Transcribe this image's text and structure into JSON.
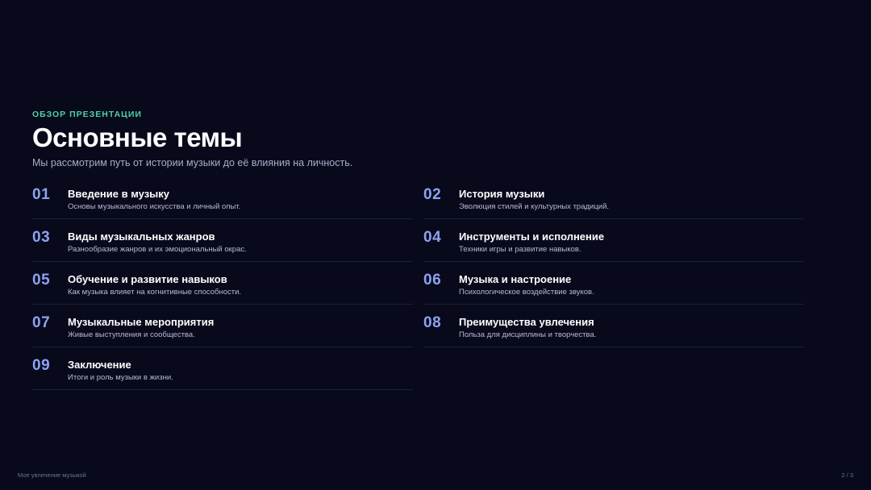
{
  "slide": {
    "eyebrow": "ОБЗОР ПРЕЗЕНТАЦИИ",
    "title": "Основные темы",
    "subtitle": "Мы рассмотрим путь от истории музыки до её влияния на личность."
  },
  "topics": [
    {
      "num": "01",
      "title": "Введение в музыку",
      "desc": "Основы музыкального искусства и личный опыт."
    },
    {
      "num": "02",
      "title": "История музыки",
      "desc": "Эволюция стилей и культурных традиций."
    },
    {
      "num": "03",
      "title": "Виды музыкальных жанров",
      "desc": "Разнообразие жанров и их эмоциональный окрас."
    },
    {
      "num": "04",
      "title": "Инструменты и исполнение",
      "desc": "Техники игры и развитие навыков."
    },
    {
      "num": "05",
      "title": "Обучение и развитие навыков",
      "desc": "Как музыка влияет на когнитивные способности."
    },
    {
      "num": "06",
      "title": "Музыка и настроение",
      "desc": "Психологическое воздействие звуков."
    },
    {
      "num": "07",
      "title": "Музыкальные мероприятия",
      "desc": "Живые выступления и сообщества."
    },
    {
      "num": "08",
      "title": "Преимущества увлечения",
      "desc": "Польза для дисциплины и творчества."
    },
    {
      "num": "09",
      "title": "Заключение",
      "desc": "Итоги и роль музыки в жизни."
    }
  ],
  "footer": {
    "left": "Мое увлечение музыкой",
    "right": "2 / 3"
  },
  "colors": {
    "background": "#080a1c",
    "accent_eyebrow": "#4fd1a5",
    "accent_numbers": "#8ea2f2"
  }
}
